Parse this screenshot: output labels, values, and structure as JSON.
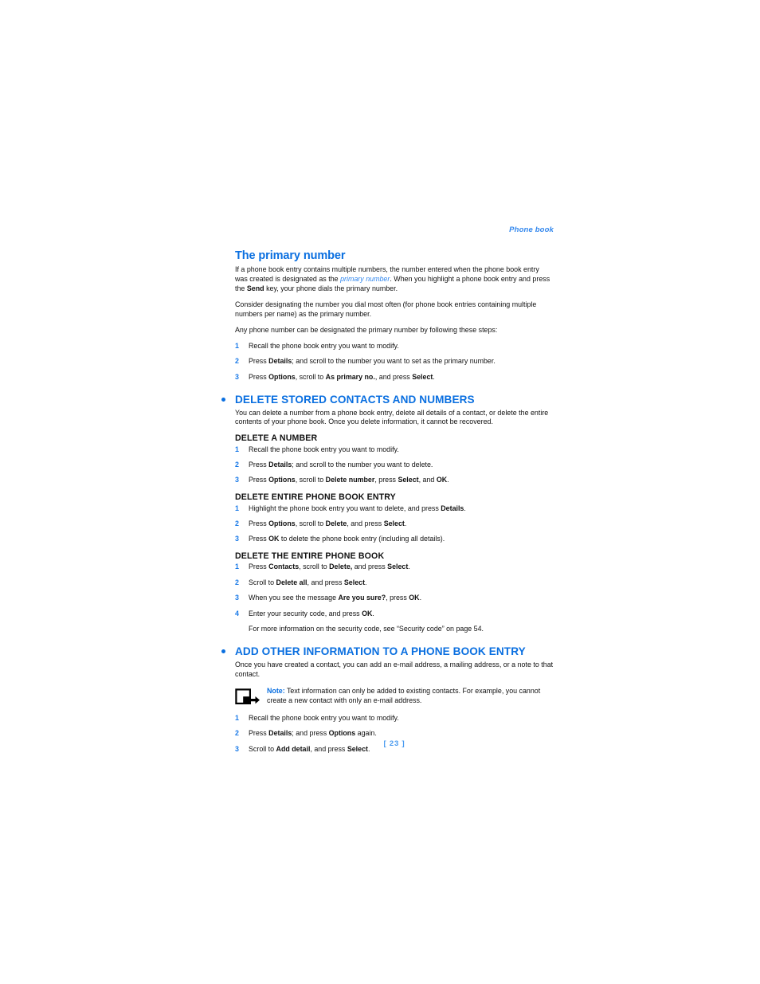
{
  "header": {
    "running_head": "Phone book"
  },
  "footer": {
    "page_number": "[ 23 ]"
  },
  "colors": {
    "heading_blue": "#0a6fe0",
    "accent_blue": "#3388ee",
    "step_number_blue": "#1a7ae8",
    "body_black": "#111111"
  },
  "sections": {
    "primary_number": {
      "heading": "The primary number",
      "para1_a": "If a phone book entry contains multiple numbers, the number entered when the phone book entry was created is designated as the ",
      "para1_link": "primary number",
      "para1_b": ". When you highlight a phone book entry and press the ",
      "para1_bold": "Send",
      "para1_c": " key, your phone dials the primary number.",
      "para2": "Consider designating the number you dial most often (for phone book entries containing multiple numbers per name) as the primary number.",
      "para3": "Any phone number can be designated the primary number by following these steps:",
      "steps": [
        {
          "num": "1",
          "parts": [
            {
              "t": "Recall the phone book entry you want to modify.",
              "b": false
            }
          ]
        },
        {
          "num": "2",
          "parts": [
            {
              "t": "Press ",
              "b": false
            },
            {
              "t": "Details",
              "b": true
            },
            {
              "t": "; and scroll to the number you want to set as the primary number.",
              "b": false
            }
          ]
        },
        {
          "num": "3",
          "parts": [
            {
              "t": "Press ",
              "b": false
            },
            {
              "t": "Options",
              "b": true
            },
            {
              "t": ", scroll to ",
              "b": false
            },
            {
              "t": "As primary no.",
              "b": true
            },
            {
              "t": ", and press ",
              "b": false
            },
            {
              "t": "Select",
              "b": true
            },
            {
              "t": ".",
              "b": false
            }
          ]
        }
      ]
    },
    "delete_stored": {
      "heading": "DELETE STORED CONTACTS AND NUMBERS",
      "intro": "You can delete a number from a phone book entry, delete all details of a contact, or delete the entire contents of your phone book. Once you delete information, it cannot be recovered.",
      "sub1": {
        "heading": "DELETE A NUMBER",
        "steps": [
          {
            "num": "1",
            "parts": [
              {
                "t": "Recall the phone book entry you want to modify.",
                "b": false
              }
            ]
          },
          {
            "num": "2",
            "parts": [
              {
                "t": "Press ",
                "b": false
              },
              {
                "t": "Details",
                "b": true
              },
              {
                "t": "; and scroll to the number you want to delete.",
                "b": false
              }
            ]
          },
          {
            "num": "3",
            "parts": [
              {
                "t": "Press ",
                "b": false
              },
              {
                "t": "Options",
                "b": true
              },
              {
                "t": ", scroll to ",
                "b": false
              },
              {
                "t": "Delete number",
                "b": true
              },
              {
                "t": ", press ",
                "b": false
              },
              {
                "t": "Select",
                "b": true
              },
              {
                "t": ", and ",
                "b": false
              },
              {
                "t": "OK",
                "b": true
              },
              {
                "t": ".",
                "b": false
              }
            ]
          }
        ]
      },
      "sub2": {
        "heading": "DELETE ENTIRE PHONE BOOK ENTRY",
        "steps": [
          {
            "num": "1",
            "parts": [
              {
                "t": "Highlight the phone book entry you want to delete, and press ",
                "b": false
              },
              {
                "t": "Details",
                "b": true
              },
              {
                "t": ".",
                "b": false
              }
            ]
          },
          {
            "num": "2",
            "parts": [
              {
                "t": "Press ",
                "b": false
              },
              {
                "t": "Options",
                "b": true
              },
              {
                "t": ", scroll to ",
                "b": false
              },
              {
                "t": "Delete",
                "b": true
              },
              {
                "t": ", and press ",
                "b": false
              },
              {
                "t": "Select",
                "b": true
              },
              {
                "t": ".",
                "b": false
              }
            ]
          },
          {
            "num": "3",
            "parts": [
              {
                "t": "Press ",
                "b": false
              },
              {
                "t": "OK",
                "b": true
              },
              {
                "t": " to delete the phone book entry (including all details).",
                "b": false
              }
            ]
          }
        ]
      },
      "sub3": {
        "heading": "DELETE THE ENTIRE PHONE BOOK",
        "steps": [
          {
            "num": "1",
            "parts": [
              {
                "t": "Press ",
                "b": false
              },
              {
                "t": "Contacts",
                "b": true
              },
              {
                "t": ", scroll to ",
                "b": false
              },
              {
                "t": "Delete,",
                "b": true
              },
              {
                "t": " and press ",
                "b": false
              },
              {
                "t": "Select",
                "b": true
              },
              {
                "t": ".",
                "b": false
              }
            ]
          },
          {
            "num": "2",
            "parts": [
              {
                "t": "Scroll to ",
                "b": false
              },
              {
                "t": "Delete all",
                "b": true
              },
              {
                "t": ", and press ",
                "b": false
              },
              {
                "t": "Select",
                "b": true
              },
              {
                "t": ".",
                "b": false
              }
            ]
          },
          {
            "num": "3",
            "parts": [
              {
                "t": "When you see the message ",
                "b": false
              },
              {
                "t": "Are you sure?",
                "b": true
              },
              {
                "t": ", press ",
                "b": false
              },
              {
                "t": "OK",
                "b": true
              },
              {
                "t": ".",
                "b": false
              }
            ]
          },
          {
            "num": "4",
            "parts": [
              {
                "t": "Enter your security code, and press ",
                "b": false
              },
              {
                "t": "OK",
                "b": true
              },
              {
                "t": ".",
                "b": false
              }
            ]
          }
        ],
        "trailing_note": "For more information on the security code, see “Security code” on page 54."
      }
    },
    "add_other_info": {
      "heading": "ADD OTHER INFORMATION TO A PHONE BOOK ENTRY",
      "intro": "Once you have created a contact, you can add an e-mail address, a mailing address, or a note to that contact.",
      "note": {
        "icon": "note-arrow-icon",
        "label": "Note:",
        "text": " Text information can only be added to existing contacts. For example, you cannot create a new contact with only an e-mail address."
      },
      "steps": [
        {
          "num": "1",
          "parts": [
            {
              "t": "Recall the phone book entry you want to modify.",
              "b": false
            }
          ]
        },
        {
          "num": "2",
          "parts": [
            {
              "t": "Press ",
              "b": false
            },
            {
              "t": "Details",
              "b": true
            },
            {
              "t": "; and press ",
              "b": false
            },
            {
              "t": "Options",
              "b": true
            },
            {
              "t": " again.",
              "b": false
            }
          ]
        },
        {
          "num": "3",
          "parts": [
            {
              "t": "Scroll to ",
              "b": false
            },
            {
              "t": "Add detail",
              "b": true
            },
            {
              "t": ", and press ",
              "b": false
            },
            {
              "t": "Select",
              "b": true
            },
            {
              "t": ".",
              "b": false
            }
          ]
        }
      ]
    }
  }
}
